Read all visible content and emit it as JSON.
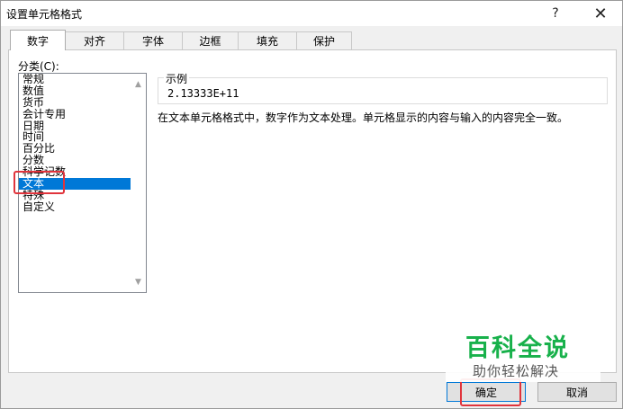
{
  "window": {
    "title": "设置单元格格式",
    "help_glyph": "?",
    "close_glyph": "✕"
  },
  "tabs": [
    {
      "label": "数字",
      "active": true
    },
    {
      "label": "对齐",
      "active": false
    },
    {
      "label": "字体",
      "active": false
    },
    {
      "label": "边框",
      "active": false
    },
    {
      "label": "填充",
      "active": false
    },
    {
      "label": "保护",
      "active": false
    }
  ],
  "category": {
    "label": "分类(C):",
    "items": [
      "常规",
      "数值",
      "货币",
      "会计专用",
      "日期",
      "时间",
      "百分比",
      "分数",
      "科学记数",
      "文本",
      "特殊",
      "自定义"
    ],
    "selected": "文本"
  },
  "sample": {
    "legend": "示例",
    "value": "2.13333E+11"
  },
  "description": "在文本单元格格式中，数字作为文本处理。单元格显示的内容与输入的内容完全一致。",
  "buttons": {
    "ok": "确定",
    "cancel": "取消"
  },
  "watermark": {
    "title": "百科全说",
    "subtitle": "助你轻松解决"
  },
  "colors": {
    "selection": "#0078d7",
    "highlight_box": "#e0343c",
    "watermark_green": "#18b14b"
  }
}
